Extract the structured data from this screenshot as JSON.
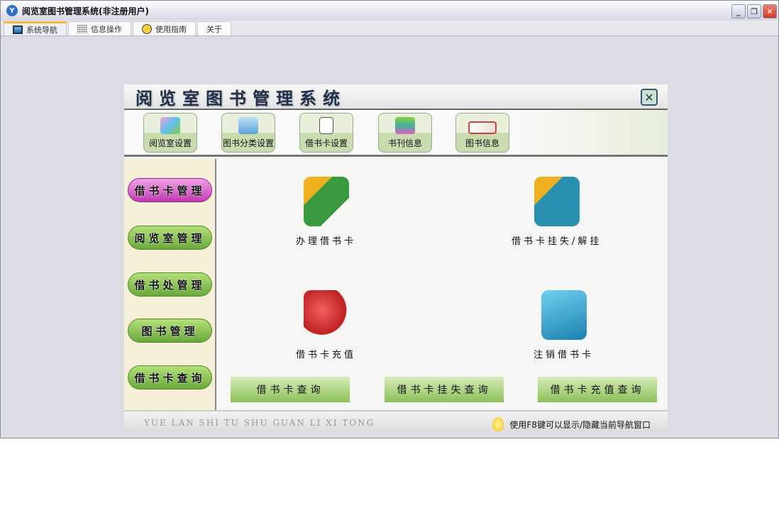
{
  "window": {
    "title": "阅览室图书管理系统(非注册用户)",
    "min": "_",
    "restore": "❐",
    "close": "✕"
  },
  "tabs": [
    {
      "label": "系统导航"
    },
    {
      "label": "信息操作"
    },
    {
      "label": "使用指南"
    },
    {
      "label": "关于"
    }
  ],
  "panel": {
    "title": "阅览室图书管理系统",
    "close": "✕",
    "toolbar": [
      {
        "label": "阅览室设置"
      },
      {
        "label": "图书分类设置"
      },
      {
        "label": "借书卡设置"
      },
      {
        "label": "书刊信息"
      },
      {
        "label": "图书信息"
      }
    ],
    "sidebar": [
      {
        "label": "借书卡管理"
      },
      {
        "label": "阅览室管理"
      },
      {
        "label": "借书处管理"
      },
      {
        "label": "图书管理"
      },
      {
        "label": "借书卡查询"
      }
    ],
    "actions": [
      {
        "label": "办理借书卡"
      },
      {
        "label": "借书卡挂失/解挂"
      },
      {
        "label": "借书卡充值"
      },
      {
        "label": "注销借书卡"
      }
    ],
    "queries": [
      {
        "label": "借书卡查询"
      },
      {
        "label": "借书卡挂失查询"
      },
      {
        "label": "借书卡充值查询"
      }
    ],
    "footer": {
      "pinyin": "YUE LAN SHI TU SHU GUAN LI XI TONG",
      "hint": "使用F8键可以显示/隐藏当前导航窗口"
    }
  }
}
